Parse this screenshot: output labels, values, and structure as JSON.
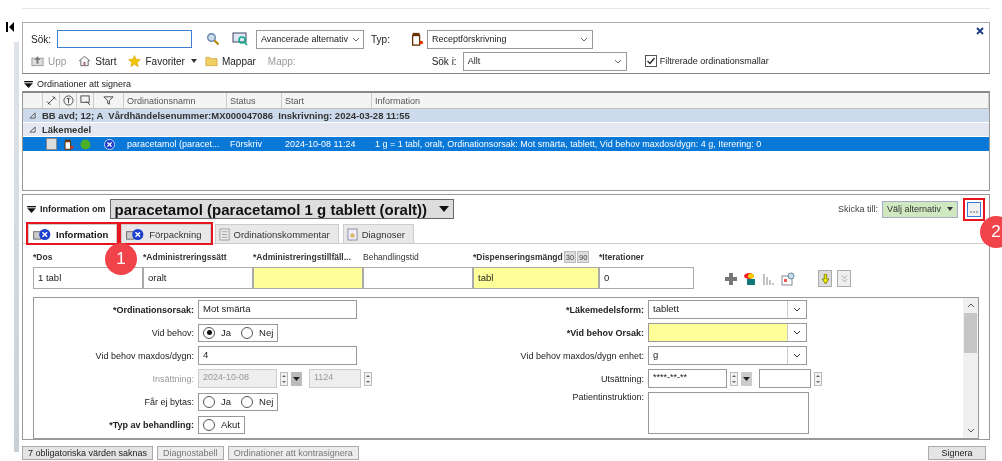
{
  "search_panel": {
    "search_label": "Sök:",
    "advanced_select": "Avancerade alternativ",
    "type_label": "Typ:",
    "type_select": "Receptförskrivning",
    "nav": [
      {
        "kind": "up",
        "label": "Upp",
        "disabled": true
      },
      {
        "kind": "home",
        "label": "Start",
        "disabled": false
      },
      {
        "kind": "star",
        "label": "Favoriter",
        "disabled": false
      },
      {
        "kind": "folder",
        "label": "Mappar",
        "disabled": false
      }
    ],
    "folder_label": "Mapp:",
    "search_in_label": "Sök i:",
    "search_in_select": "Allt",
    "filter_checkbox": {
      "label": "Filtrerade ordinationsmallar",
      "checked": true
    }
  },
  "orders_section": {
    "title": "Ordinationer att signera",
    "expanded": true,
    "columns": [
      "Ordinationsnamn",
      "Status",
      "Start",
      "Information"
    ],
    "groups": [
      {
        "label": "BB avd; 12; A  Vårdhändelsenummer:MX000047086  Inskrivning: 2024-03-28 11:55",
        "expanded": true
      },
      {
        "label": "Läkemedel",
        "expanded": true
      }
    ],
    "rows": [
      {
        "name": "paracetamol (paracet...",
        "status": "Förskriv",
        "start": "2024-10-08 11:24",
        "information": "1 g = 1 tabl, oralt, Ordinationsorsak: Mot smärta, tablett, Vid behov maxdos/dygn: 4 g, Iterering: 0",
        "selected": true,
        "checked": false
      }
    ]
  },
  "detail": {
    "info_label": "Information om",
    "product_select": "paracetamol (paracetamol 1 g tablett (oralt))",
    "send_label": "Skicka till:",
    "send_select": "Välj alternativ",
    "tabs": [
      {
        "kind": "info",
        "label": "Information",
        "selected": true
      },
      {
        "kind": "package",
        "label": "Förpackning",
        "selected": false
      },
      {
        "kind": "comment",
        "label": "Ordinationskommentar",
        "selected": false
      },
      {
        "kind": "diagnosis",
        "label": "Diagnoser",
        "selected": false
      }
    ],
    "top_fields": [
      {
        "label": "*Dos",
        "value": "1 tabl",
        "highlighted": false
      },
      {
        "label": "*Administreringssätt",
        "value": "oralt",
        "highlighted": false
      },
      {
        "label": "*Administreringstillfäll...",
        "highlighted": true
      },
      {
        "label": "Behandlingstid",
        "highlighted": false
      },
      {
        "label": "*Dispenseringsmängd",
        "value": "tabl",
        "highlighted": true,
        "quick_buttons": [
          "30",
          "90"
        ]
      },
      {
        "label": "*Iterationer",
        "value": "0",
        "highlighted": false
      }
    ],
    "left_rows": [
      {
        "kind": "text",
        "label": "*Ordinationsorsak:",
        "value": "Mot smärta"
      },
      {
        "kind": "radio",
        "label": "Vid behov:",
        "options": [
          {
            "label": "Ja",
            "selected": true
          },
          {
            "label": "Nej",
            "selected": false
          }
        ]
      },
      {
        "kind": "text",
        "label": "Vid behov maxdos/dygn:",
        "value": "4"
      },
      {
        "kind": "datetime",
        "label": "Insättning:",
        "date": "2024-10-08",
        "time": "1124",
        "disabled": true
      },
      {
        "kind": "radio",
        "label": "Får ej bytas:",
        "options": [
          {
            "label": "Ja",
            "selected": false
          },
          {
            "label": "Nej",
            "selected": false
          }
        ]
      },
      {
        "kind": "radio",
        "label": "*Typ av behandling:",
        "options": [
          {
            "label": "Akut",
            "selected": false
          }
        ]
      }
    ],
    "right_rows": [
      {
        "kind": "select",
        "label": "*Läkemedelsform:",
        "value": "tablett",
        "highlighted": false
      },
      {
        "kind": "select",
        "label": "*Vid behov Orsak:",
        "highlighted": true
      },
      {
        "kind": "select",
        "label": "Vid behov maxdos/dygn enhet:",
        "value": "g",
        "highlighted": false
      },
      {
        "kind": "datetime",
        "label": "Utsättning:",
        "date": "****-**-**",
        "disabled": false
      },
      {
        "kind": "textarea",
        "label": "Patientinstruktion:"
      }
    ]
  },
  "bottom_buttons": [
    {
      "label": "7 obligatoriska värden saknas",
      "disabled": false
    },
    {
      "label": "Diagnostabell",
      "disabled": true
    },
    {
      "label": "Ordinationer att kontrasignera",
      "disabled": true
    }
  ],
  "sign_button": "Signera",
  "annotations": [
    {
      "label": "1"
    },
    {
      "label": "2"
    }
  ]
}
